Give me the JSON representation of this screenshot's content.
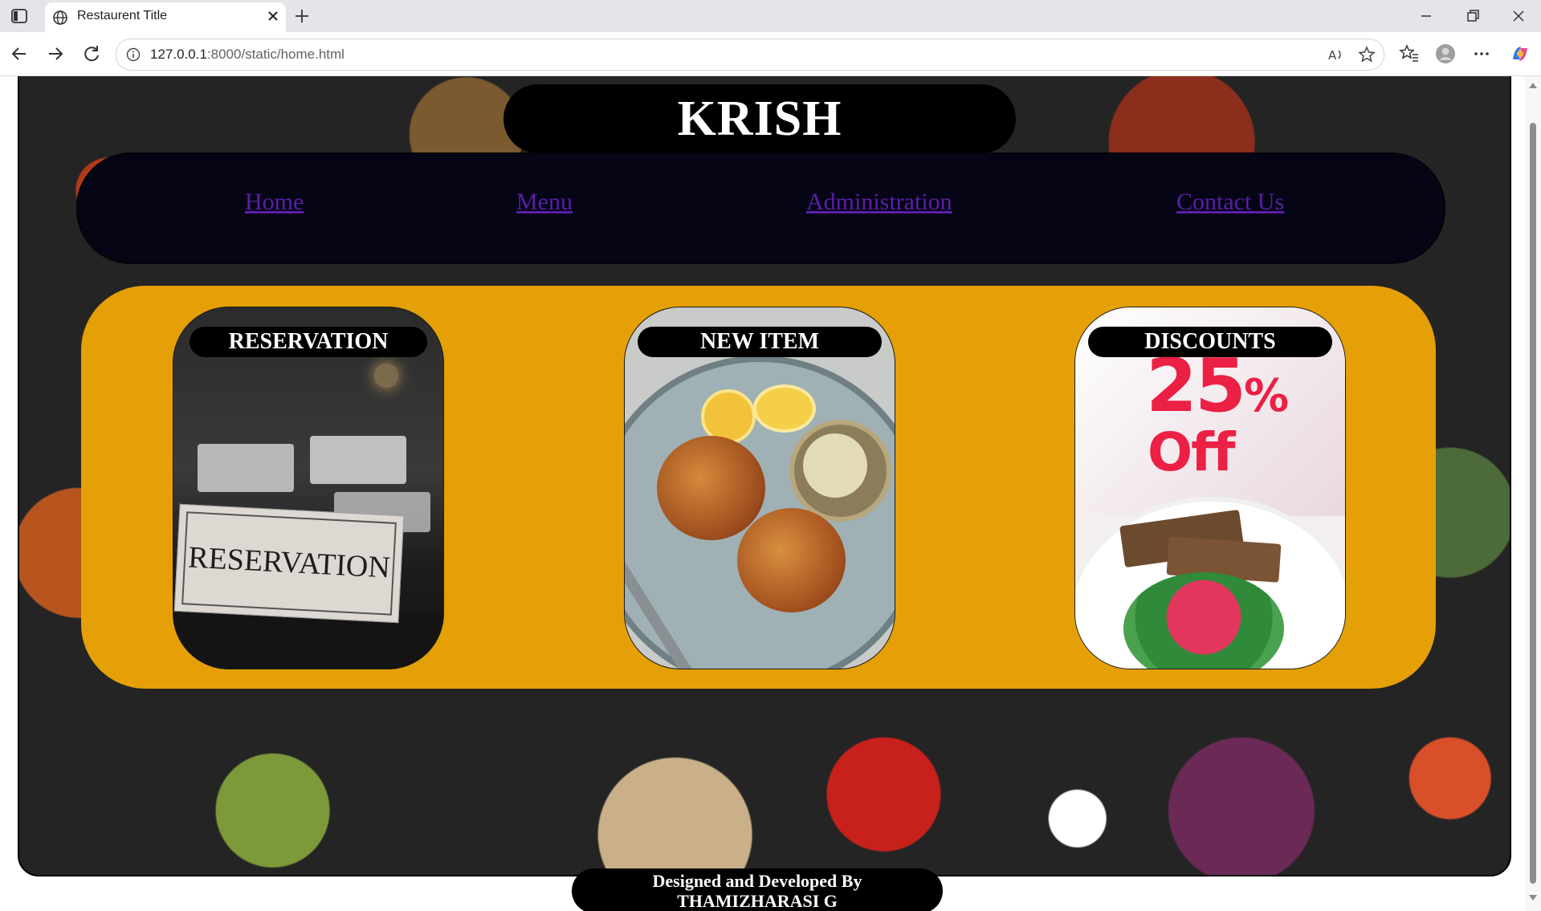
{
  "browser": {
    "tab_title": "Restaurent Title",
    "url_host": "127.0.0.1",
    "url_rest": ":8000/static/home.html"
  },
  "page": {
    "brand": "KRISH",
    "nav": [
      {
        "label": "Home"
      },
      {
        "label": "Menu"
      },
      {
        "label": "Administration"
      },
      {
        "label": "Contact Us"
      }
    ],
    "cards": [
      {
        "label": "RESERVATION",
        "sign_text": "RESERVATION"
      },
      {
        "label": "NEW ITEM"
      },
      {
        "label": "DISCOUNTS",
        "percent": "25",
        "percent_sign": "%",
        "off": "Off"
      }
    ],
    "footer_line1": "Designed and Developed By",
    "footer_line2": "THAMIZHARASI G"
  },
  "colors": {
    "panel": "#e4a006",
    "navbar": "#050516",
    "link": "#5b1ea8",
    "discount_red": "#ec1f45"
  },
  "icons": [
    "sidebar-icon",
    "globe-icon",
    "close-icon",
    "plus-icon",
    "minimize-icon",
    "restore-icon",
    "window-close-icon",
    "back-icon",
    "forward-icon",
    "refresh-icon",
    "info-icon",
    "read-aloud-icon",
    "star-icon",
    "favorites-icon",
    "profile-icon",
    "more-icon",
    "copilot-icon"
  ]
}
